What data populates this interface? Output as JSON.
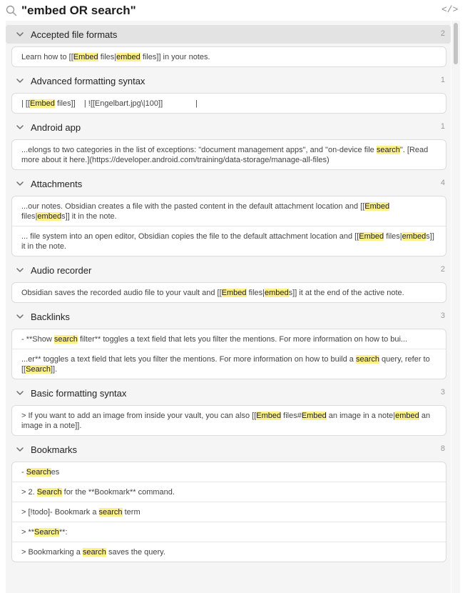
{
  "search": {
    "query": "\"embed OR search\""
  },
  "toolbar": {
    "code_toggle": "</>"
  },
  "icons": {
    "search": "search-icon",
    "code": "code-icon",
    "collapse": "chevron-down-icon"
  },
  "colors": {
    "highlight": "#fbf08a",
    "hover_row": "#e3e3e3",
    "panel_bg": "#f5f5f5"
  },
  "groups": [
    {
      "title": "Accepted file formats",
      "count": "2",
      "highlighted": true,
      "matches": [
        [
          {
            "t": "Learn how to [["
          },
          {
            "t": "Embed",
            "h": true
          },
          {
            "t": " files|"
          },
          {
            "t": "embed",
            "h": true
          },
          {
            "t": " files]] in your notes."
          }
        ]
      ]
    },
    {
      "title": "Advanced formatting syntax",
      "count": "1",
      "matches": [
        [
          {
            "t": "| [["
          },
          {
            "t": "Embed",
            "h": true
          },
          {
            "t": " files]]    | ![[Engelbart.jpg\\|100]]               |"
          }
        ]
      ]
    },
    {
      "title": "Android app",
      "count": "1",
      "matches": [
        [
          {
            "t": "...elongs to two categories in the list of exceptions: \"document management apps\", and \"on-device file "
          },
          {
            "t": "search",
            "h": true
          },
          {
            "t": "\". [Read more about it here.](https://developer.android.com/training/data-storage/manage-all-files)"
          }
        ]
      ]
    },
    {
      "title": "Attachments",
      "count": "4",
      "matches": [
        [
          {
            "t": "...our notes. Obsidian creates a file with the pasted content in the default attachment location and [["
          },
          {
            "t": "Embed",
            "h": true
          },
          {
            "t": " files|"
          },
          {
            "t": "embed",
            "h": true
          },
          {
            "t": "s]] it in the note."
          }
        ],
        [
          {
            "t": "... file system into an open editor, Obsidian copies the file to the default attachment location and [["
          },
          {
            "t": "Embed",
            "h": true
          },
          {
            "t": " files|"
          },
          {
            "t": "embed",
            "h": true
          },
          {
            "t": "s]] it in the note."
          }
        ]
      ]
    },
    {
      "title": "Audio recorder",
      "count": "2",
      "matches": [
        [
          {
            "t": "Obsidian saves the recorded audio file to your vault and [["
          },
          {
            "t": "Embed",
            "h": true
          },
          {
            "t": " files|"
          },
          {
            "t": "embed",
            "h": true
          },
          {
            "t": "s]] it at the end of the active note."
          }
        ]
      ]
    },
    {
      "title": "Backlinks",
      "count": "3",
      "matches": [
        [
          {
            "t": "- **Show "
          },
          {
            "t": "search",
            "h": true
          },
          {
            "t": " filter** toggles a text field that lets you filter the mentions. For more information on how to bui..."
          }
        ],
        [
          {
            "t": "...er** toggles a text field that lets you filter the mentions. For more information on how to build a "
          },
          {
            "t": "search",
            "h": true
          },
          {
            "t": " query, refer to [["
          },
          {
            "t": "Search",
            "h": true
          },
          {
            "t": "]]."
          }
        ]
      ]
    },
    {
      "title": "Basic formatting syntax",
      "count": "3",
      "matches": [
        [
          {
            "t": "> If you want to add an image from inside your vault, you can also [["
          },
          {
            "t": "Embed",
            "h": true
          },
          {
            "t": " files#"
          },
          {
            "t": "Embed",
            "h": true
          },
          {
            "t": " an image in a note|"
          },
          {
            "t": "embed",
            "h": true
          },
          {
            "t": " an image in a note]]."
          }
        ]
      ]
    },
    {
      "title": "Bookmarks",
      "count": "8",
      "matches": [
        [
          {
            "t": "- "
          },
          {
            "t": "Search",
            "h": true
          },
          {
            "t": "es"
          }
        ],
        [
          {
            "t": "> 2. "
          },
          {
            "t": "Search",
            "h": true
          },
          {
            "t": " for the **Bookmark** command."
          }
        ],
        [
          {
            "t": "> [!todo]- Bookmark a "
          },
          {
            "t": "search",
            "h": true
          },
          {
            "t": " term"
          }
        ],
        [
          {
            "t": "> **"
          },
          {
            "t": "Search",
            "h": true
          },
          {
            "t": "**:"
          }
        ],
        [
          {
            "t": "> Bookmarking a "
          },
          {
            "t": "search",
            "h": true
          },
          {
            "t": " saves the query."
          }
        ]
      ]
    }
  ]
}
